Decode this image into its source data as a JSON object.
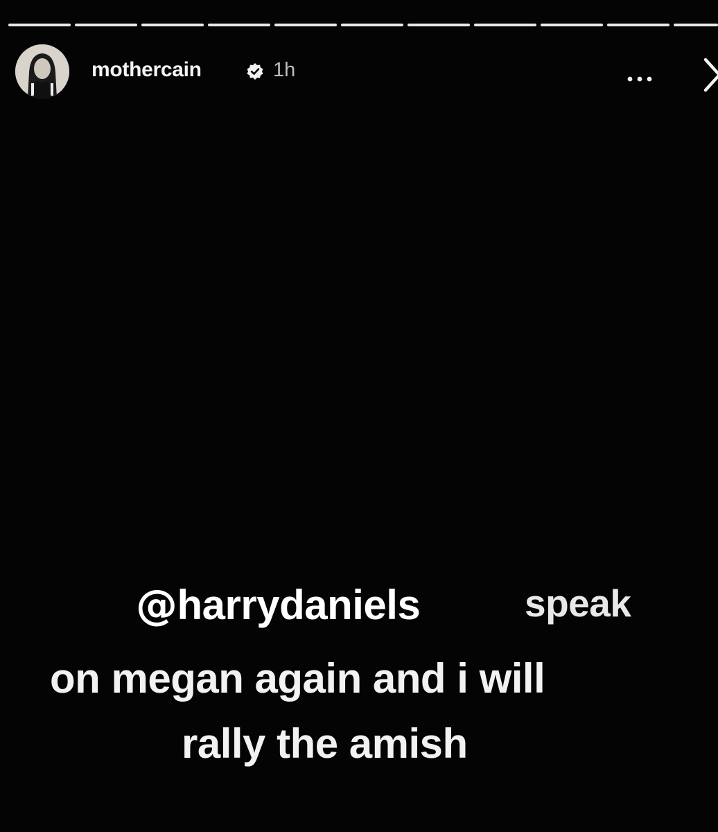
{
  "story": {
    "segment_count": 11,
    "header": {
      "username": "mothercain",
      "time": "1h",
      "verified_icon": "verified-badge-icon",
      "more_icon": "more-options-icon",
      "close_icon": "close-icon"
    },
    "caption": {
      "mention_symbol": "@",
      "mention_name": "harrydaniels",
      "line1_word": "speak",
      "line2": "on megan again and i will",
      "line3": "rally the amish"
    }
  }
}
